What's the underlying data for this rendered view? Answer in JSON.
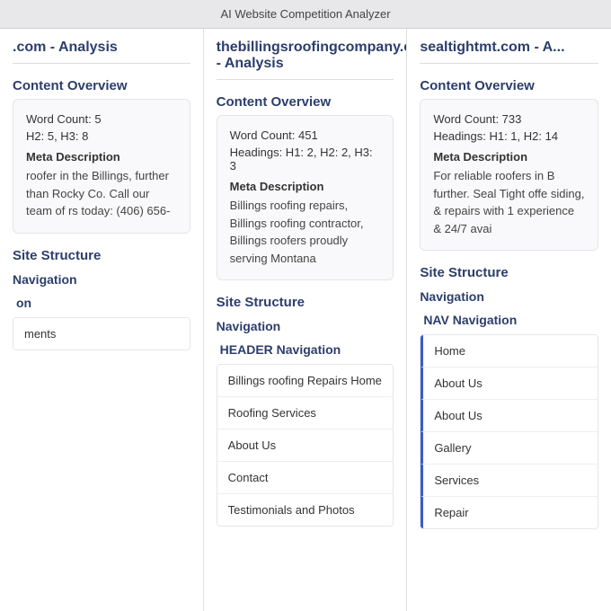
{
  "topBar": {
    "title": "AI Website Competition Analyzer"
  },
  "columns": [
    {
      "id": "col1",
      "title": ".com - Analysis",
      "contentOverview": {
        "sectionTitle": "Content Overview",
        "stats": [
          "Word Count: 5",
          "H2: 5, H3: 8"
        ],
        "metaLabel": "Meta Description",
        "metaText": "roofer in the Billings, further than Rocky Co. Call our team of rs today: (406) 656-"
      },
      "siteStructure": {
        "sectionTitle": "Site Structure",
        "navigation": {
          "label": "Navigation",
          "navType": "n",
          "navTypeLabel": "on",
          "items": [
            "ments"
          ]
        }
      }
    },
    {
      "id": "col2",
      "title": "thebillingsroofingcompany.com - Analysis",
      "contentOverview": {
        "sectionTitle": "Content Overview",
        "stats": [
          "Word Count: 451",
          "Headings: H1: 2, H2: 2, H3: 3"
        ],
        "metaLabel": "Meta Description",
        "metaText": "Billings roofing repairs, Billings roofing contractor, Billings roofers proudly serving Montana"
      },
      "siteStructure": {
        "sectionTitle": "Site Structure",
        "navigation": {
          "label": "Navigation",
          "navTypeLabel": "HEADER Navigation",
          "items": [
            "Billings roofing Repairs Home",
            "Roofing Services",
            "About Us",
            "Contact",
            "Testimonials and Photos"
          ]
        }
      }
    },
    {
      "id": "col3",
      "title": "sealtightmt.com - A...",
      "contentOverview": {
        "sectionTitle": "Content Overview",
        "stats": [
          "Word Count: 733",
          "Headings: H1: 1, H2: 14"
        ],
        "metaLabel": "Meta Description",
        "metaText": "For reliable roofers in B further. Seal Tight offe siding, & repairs with 1 experience & 24/7 avai"
      },
      "siteStructure": {
        "sectionTitle": "Site Structure",
        "navigation": {
          "label": "Navigation",
          "navTypeLabel": "NAV Navigation",
          "items": [
            "Home",
            "About Us",
            "About Us",
            "Gallery",
            "Services",
            "Repair"
          ]
        }
      }
    }
  ]
}
